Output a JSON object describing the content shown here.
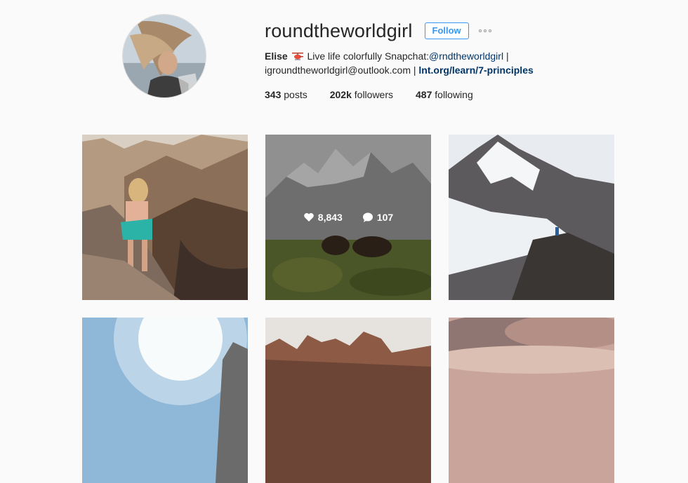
{
  "profile": {
    "username": "roundtheworldgirl",
    "follow_label": "Follow",
    "bio_name": "Elise",
    "bio_text": "Live life colorfully Snapchat:",
    "snapchat_handle": "@rndtheworldgirl",
    "separator": "|",
    "email": "igroundtheworldgirl@outlook.com",
    "separator2": "|",
    "link": "lnt.org/learn/7-principles",
    "emoji_icon": "helicopter-icon"
  },
  "stats": {
    "posts_count": "343",
    "posts_label": "posts",
    "followers_count": "202k",
    "followers_label": "followers",
    "following_count": "487",
    "following_label": "following"
  },
  "hover_tile": {
    "likes": "8,843",
    "comments": "107"
  },
  "colors": {
    "accent": "#3897f0",
    "link": "#003569",
    "background": "#fafafa"
  }
}
